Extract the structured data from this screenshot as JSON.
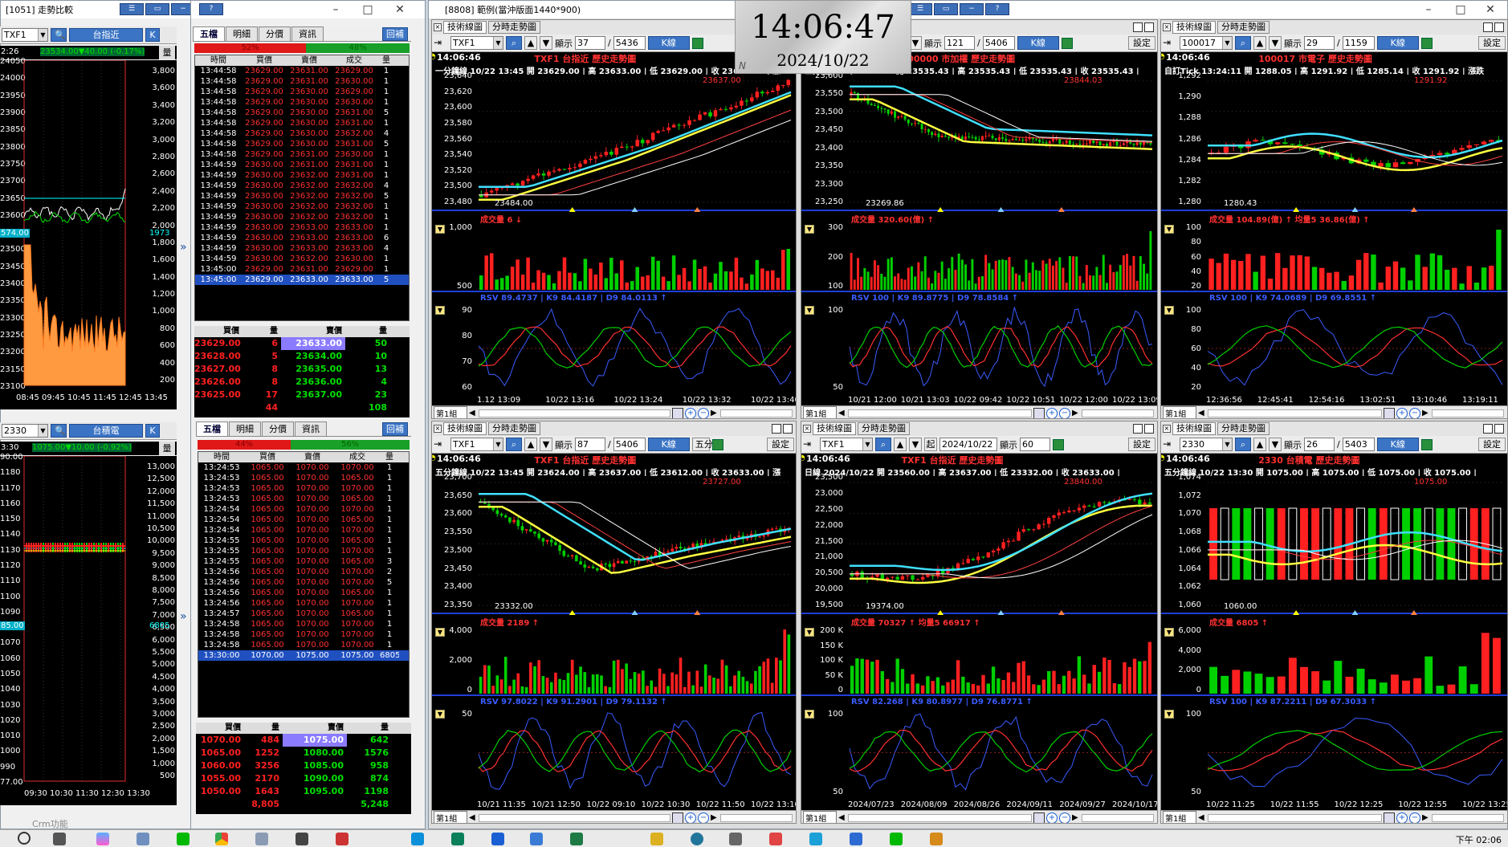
{
  "clock": {
    "time": "14:06:47",
    "date": "2024/10/22"
  },
  "left_window": {
    "title": "[1051] 走勢比較",
    "win_buttons": [
      "☰",
      "▭",
      "−",
      "?"
    ],
    "top": {
      "symbol": "TXF1",
      "name": "台指近",
      "k_btn": "K",
      "time": "2:26",
      "quote": "23534.00▼40.00 (-0.17%)",
      "qty_btn": "量",
      "price_axis": [
        "24050",
        "24000",
        "23950",
        "23900",
        "23850",
        "23800",
        "23750",
        "23700",
        "23650",
        "23600",
        "23550",
        "23500",
        "23450",
        "23400",
        "23350",
        "23300",
        "23250",
        "23200",
        "23150",
        "23100"
      ],
      "vol_axis": [
        "3,800",
        "3,600",
        "3,400",
        "3,200",
        "3,000",
        "2,800",
        "2,600",
        "2,400",
        "2,200",
        "2,000",
        "1,800",
        "1,600",
        "1,400",
        "1,200",
        "1,000",
        "800",
        "600",
        "400",
        "200"
      ],
      "cursor_price": "574.00",
      "vol_marker": "1973",
      "time_axis": "08:45 09:45 10:45 11:45 12:45 13:45"
    },
    "bottom": {
      "symbol": "2330",
      "name": "台積電",
      "k_btn": "K",
      "time": "3:30",
      "quote": "1075.00▼10.00 (-0.92%)",
      "qty_btn": "量",
      "price_axis": [
        "90.00",
        "1180",
        "1170",
        "1160",
        "1150",
        "1140",
        "1130",
        "1120",
        "1110",
        "1100",
        "1090",
        "1080",
        "1070",
        "1060",
        "1050",
        "1040",
        "1030",
        "1020",
        "1010",
        "1000",
        "990",
        "77.00"
      ],
      "vol_axis": [
        "13,000",
        "12,500",
        "12,000",
        "11,500",
        "11,000",
        "10,500",
        "10,000",
        "9,500",
        "9,000",
        "8,500",
        "8,000",
        "7,500",
        "7,000",
        "6,500",
        "6,000",
        "5,500",
        "5,000",
        "4,500",
        "4,000",
        "3,500",
        "3,000",
        "2,500",
        "2,000",
        "1,500",
        "1,000",
        "500"
      ],
      "cursor_price": "85.00",
      "vol_marker": "6805",
      "time_axis": "09:30  10:30  11:30  12:30  13:30"
    },
    "crm": "Crm功能"
  },
  "order_book_top": {
    "tabs": [
      "五檔",
      "明細",
      "分價",
      "資訊"
    ],
    "return_btn": "回補",
    "ratio_left": "52%",
    "ratio_right": "48%",
    "headers": [
      "時間",
      "買價",
      "賣價",
      "成交",
      "量"
    ],
    "ticks": [
      [
        "13:44:58",
        "23629.00",
        "23631.00",
        "23629.00",
        "1"
      ],
      [
        "13:44:58",
        "23629.00",
        "23631.00",
        "23630.00",
        "1"
      ],
      [
        "13:44:58",
        "23629.00",
        "23630.00",
        "23629.00",
        "1"
      ],
      [
        "13:44:58",
        "23629.00",
        "23630.00",
        "23630.00",
        "1"
      ],
      [
        "13:44:58",
        "23629.00",
        "23630.00",
        "23631.00",
        "5"
      ],
      [
        "13:44:58",
        "23629.00",
        "23630.00",
        "23631.00",
        "1"
      ],
      [
        "13:44:58",
        "23629.00",
        "23630.00",
        "23632.00",
        "4"
      ],
      [
        "13:44:58",
        "23629.00",
        "23630.00",
        "23631.00",
        "5"
      ],
      [
        "13:44:58",
        "23629.00",
        "23631.00",
        "23630.00",
        "1"
      ],
      [
        "13:44:59",
        "23630.00",
        "23631.00",
        "23631.00",
        "1"
      ],
      [
        "13:44:59",
        "23630.00",
        "23632.00",
        "23631.00",
        "1"
      ],
      [
        "13:44:59",
        "23630.00",
        "23632.00",
        "23632.00",
        "4"
      ],
      [
        "13:44:59",
        "23630.00",
        "23632.00",
        "23632.00",
        "5"
      ],
      [
        "13:44:59",
        "23630.00",
        "23632.00",
        "23632.00",
        "1"
      ],
      [
        "13:44:59",
        "23630.00",
        "23632.00",
        "23632.00",
        "1"
      ],
      [
        "13:44:59",
        "23630.00",
        "23633.00",
        "23633.00",
        "1"
      ],
      [
        "13:44:59",
        "23630.00",
        "23633.00",
        "23633.00",
        "6"
      ],
      [
        "13:44:59",
        "23630.00",
        "23633.00",
        "23633.00",
        "4"
      ],
      [
        "13:44:59",
        "23630.00",
        "23632.00",
        "23630.00",
        "1"
      ],
      [
        "13:45:00",
        "23629.00",
        "23631.00",
        "23629.00",
        "1"
      ],
      [
        "13:45:00",
        "23629.00",
        "23633.00",
        "23633.00",
        "5"
      ]
    ],
    "book_headers": [
      "買價",
      "量",
      "賣價",
      "量"
    ],
    "book": [
      [
        "23629.00",
        "6",
        "23633.00",
        "50"
      ],
      [
        "23628.00",
        "5",
        "23634.00",
        "10"
      ],
      [
        "23627.00",
        "8",
        "23635.00",
        "13"
      ],
      [
        "23626.00",
        "8",
        "23636.00",
        "4"
      ],
      [
        "23625.00",
        "17",
        "23637.00",
        "23"
      ]
    ],
    "totals": [
      "44",
      "108"
    ]
  },
  "order_book_bottom": {
    "tabs": [
      "五檔",
      "明細",
      "分價",
      "資訊"
    ],
    "return_btn": "回補",
    "ratio_left": "44%",
    "ratio_right": "56%",
    "headers": [
      "時間",
      "買價",
      "賣價",
      "成交",
      "量"
    ],
    "ticks": [
      [
        "13:24:53",
        "1065.00",
        "1070.00",
        "1070.00",
        "1"
      ],
      [
        "13:24:53",
        "1065.00",
        "1070.00",
        "1065.00",
        "1"
      ],
      [
        "13:24:53",
        "1065.00",
        "1070.00",
        "1070.00",
        "1"
      ],
      [
        "13:24:53",
        "1065.00",
        "1070.00",
        "1065.00",
        "1"
      ],
      [
        "13:24:54",
        "1065.00",
        "1070.00",
        "1070.00",
        "1"
      ],
      [
        "13:24:54",
        "1065.00",
        "1070.00",
        "1065.00",
        "1"
      ],
      [
        "13:24:54",
        "1065.00",
        "1070.00",
        "1070.00",
        "1"
      ],
      [
        "13:24:55",
        "1065.00",
        "1070.00",
        "1065.00",
        "1"
      ],
      [
        "13:24:55",
        "1065.00",
        "1070.00",
        "1070.00",
        "1"
      ],
      [
        "13:24:55",
        "1065.00",
        "1070.00",
        "1065.00",
        "3"
      ],
      [
        "13:24:56",
        "1065.00",
        "1070.00",
        "1070.00",
        "2"
      ],
      [
        "13:24:56",
        "1065.00",
        "1070.00",
        "1070.00",
        "5"
      ],
      [
        "13:24:56",
        "1065.00",
        "1070.00",
        "1065.00",
        "1"
      ],
      [
        "13:24:56",
        "1065.00",
        "1070.00",
        "1070.00",
        "1"
      ],
      [
        "13:24:57",
        "1065.00",
        "1070.00",
        "1065.00",
        "1"
      ],
      [
        "13:24:58",
        "1065.00",
        "1070.00",
        "1070.00",
        "1"
      ],
      [
        "13:24:58",
        "1065.00",
        "1070.00",
        "1070.00",
        "1"
      ],
      [
        "13:24:58",
        "1065.00",
        "1070.00",
        "1070.00",
        "1"
      ],
      [
        "13:30:00",
        "1070.00",
        "1075.00",
        "1075.00",
        "6805"
      ]
    ],
    "book_headers": [
      "買價",
      "量",
      "賣價",
      "量"
    ],
    "book": [
      [
        "1070.00",
        "484",
        "1075.00",
        "642"
      ],
      [
        "1065.00",
        "1252",
        "1080.00",
        "1576"
      ],
      [
        "1060.00",
        "3256",
        "1085.00",
        "958"
      ],
      [
        "1055.00",
        "2170",
        "1090.00",
        "874"
      ],
      [
        "1050.00",
        "1643",
        "1095.00",
        "1198"
      ]
    ],
    "totals": [
      "8,805",
      "5,248"
    ]
  },
  "main_window": {
    "title": "[8808] 範例(當沖版面1440*900)",
    "win_buttons": [
      "☰",
      "▭",
      "−",
      "?"
    ],
    "charts": [
      {
        "tabs": [
          "技術線圖",
          "分時走勢圖"
        ],
        "symbol": "TXF1",
        "display_lbl": "顯示",
        "count": "37",
        "total": "5436",
        "kline": "K線",
        "set": "設定",
        "clock": "14:06:46",
        "title": "TXF1 台指近  歷史走勢圖",
        "header": "一分鐘線 10/22 13:45 開 23629.00 | 高 23633.00 | 低 23629.00 | 收 23633.00 | 漲",
        "price_axis": [
          "23,640",
          "23,620",
          "23,600",
          "23,580",
          "23,560",
          "23,540",
          "23,520",
          "23,500",
          "23,480"
        ],
        "hi_mark": "23637.00",
        "lo_mark": "23484.00",
        "vol_title": "成交量 6 ↓",
        "vol_axis": [
          "1,000",
          "500"
        ],
        "kd_title": "RSV 89.4737 | K9 84.4187 | D9 84.0113 ↑",
        "kd_axis": [
          "90",
          "80",
          "70",
          "60"
        ],
        "x_axis": [
          "1.12 13:09",
          "10/22 13:16",
          "10/22 13:24",
          "10/22 13:32",
          "10/22 13:40"
        ],
        "group": "第1組"
      },
      {
        "tabs": [
          "技術線圖",
          "分時走勢圖"
        ],
        "symbol": "100000",
        "display_lbl": "顯示",
        "count": "121",
        "total": "5406",
        "kline": "K線",
        "set": "設定",
        "clock": "14:06:46",
        "title": "100000 市加權  歷史走勢圖",
        "header": "三分鐘線 10/22 13:30 開 23535.43 | 高 23535.43 | 低 23535.43 | 收 23535.43 |",
        "price_axis": [
          "23,600",
          "23,550",
          "23,500",
          "23,450",
          "23,400",
          "23,350",
          "23,300",
          "23,250"
        ],
        "hi_mark": "23844.03",
        "lo_mark": "23269.86",
        "vol_title": "成交量 320.60(億) ↑",
        "vol_axis": [
          "300",
          "200",
          "100"
        ],
        "kd_title": "RSV 100 | K9 89.8775 | D9 78.8584 ↑",
        "kd_axis": [
          "100",
          "50"
        ],
        "x_axis": [
          "10/21 12:00",
          "10/21 13:03",
          "10/22 09:42",
          "10/22 10:51",
          "10/22 12:00",
          "10/22 13:09"
        ],
        "group": "第1組"
      },
      {
        "tabs": [
          "技術線圖",
          "分時走勢圖"
        ],
        "symbol": "100017",
        "display_lbl": "顯示",
        "count": "29",
        "total": "1159",
        "kline": "K線",
        "set": "設定",
        "clock": "14:06:46",
        "title": "100017 市電子  歷史走勢圖",
        "header": "自訂Tick 13:24:11 開 1288.05 | 高 1291.92 | 低 1285.14 | 收 1291.92 | 漲跌",
        "price_axis": [
          "1,292",
          "1,290",
          "1,288",
          "1,286",
          "1,284",
          "1,282",
          "1,280"
        ],
        "hi_mark": "1291.92",
        "lo_mark": "1280.43",
        "vol_title": "成交量 104.89(億) ↑  均量5 36.86(億) ↑",
        "vol_axis": [
          "100",
          "80",
          "60",
          "40",
          "20"
        ],
        "kd_title": "RSV 100 | K9 74.0689 | D9 69.8551 ↑",
        "kd_axis": [
          "100",
          "80",
          "60",
          "40",
          "20"
        ],
        "x_axis": [
          "12:36:56",
          "12:45:41",
          "12:54:16",
          "13:02:51",
          "13:10:46",
          "13:19:11"
        ],
        "group": "第1組"
      },
      {
        "tabs": [
          "技術線圖",
          "分時走勢圖"
        ],
        "symbol": "TXF1",
        "display_lbl": "顯示",
        "count": "87",
        "total": "5406",
        "kline": "K線",
        "set": "設定",
        "extra": "五分",
        "clock": "14:06:46",
        "title": "TXF1 台指近  歷史走勢圖",
        "header": "五分鐘線 10/22 13:45 開 23624.00 | 高 23637.00 | 低 23612.00 | 收 23633.00 | 漲",
        "price_axis": [
          "23,700",
          "23,650",
          "23,600",
          "23,550",
          "23,500",
          "23,450",
          "23,400",
          "23,350"
        ],
        "hi_mark": "23727.00",
        "lo_mark": "23332.00",
        "vol_title": "成交量 2189 ↑",
        "vol_axis": [
          "4,000",
          "2,000",
          "0"
        ],
        "kd_title": "RSV 97.8022 | K9 91.2901 | D9 79.1132 ↑",
        "kd_axis": [
          "50"
        ],
        "x_axis": [
          "10/21 11:35",
          "10/21 12:50",
          "10/22 09:10",
          "10/22 10:30",
          "10/22 11:50",
          "10/22 13:10"
        ],
        "group": "第1組"
      },
      {
        "tabs": [
          "技術線圖",
          "分時走勢圖"
        ],
        "symbol": "TXF1",
        "display_lbl": "顯示",
        "count": "60",
        "total": "",
        "kline": "",
        "set": "設定",
        "start_lbl": "起",
        "start_date": "2024/10/22",
        "clock": "14:06:46",
        "title": "TXF1 台指近  歷史走勢圖",
        "header": "日線 2024/10/22 開 23560.00 | 高 23637.00 | 低 23332.00 | 收 23633.00 |",
        "price_axis": [
          "23,500",
          "23,000",
          "22,500",
          "22,000",
          "21,500",
          "21,000",
          "20,500",
          "20,000",
          "19,500"
        ],
        "hi_mark": "23840.00",
        "lo_mark": "19374.00",
        "vol_title": "成交量 70327 ↑  均量5 66917 ↑",
        "vol_axis": [
          "200 K",
          "150 K",
          "100 K",
          "50 K",
          "0"
        ],
        "kd_title": "RSV 82.268 | K9 80.8977 | D9 76.8771 ↑",
        "kd_axis": [
          "100",
          "50"
        ],
        "x_axis": [
          "2024/07/23",
          "2024/08/09",
          "2024/08/26",
          "2024/09/11",
          "2024/09/27",
          "2024/10/17"
        ],
        "group": "第1組"
      },
      {
        "tabs": [
          "技術線圖",
          "分時走勢圖"
        ],
        "symbol": "2330",
        "display_lbl": "顯示",
        "count": "26",
        "total": "5403",
        "kline": "K線",
        "set": "設定",
        "clock": "14:06:46",
        "title": "2330 台積電  歷史走勢圖",
        "header": "五分鐘線 10/22 13:30 開 1075.00 | 高 1075.00 | 低 1075.00 | 收 1075.00 |",
        "price_axis": [
          "1,074",
          "1,072",
          "1,070",
          "1,068",
          "1,066",
          "1,064",
          "1,062",
          "1,060"
        ],
        "hi_mark": "1075.00",
        "lo_mark": "1060.00",
        "vol_title": "成交量 6805 ↑",
        "vol_axis": [
          "6,000",
          "4,000",
          "2,000",
          "0"
        ],
        "kd_title": "RSV 100 | K9 87.2211 | D9 67.3033 ↑",
        "kd_axis": [
          "100",
          "50"
        ],
        "x_axis": [
          "10/22 11:25",
          "10/22 11:55",
          "10/22 12:25",
          "10/22 12:55",
          "10/22 13:25"
        ],
        "group": "第1組"
      }
    ]
  },
  "taskbar": {
    "clock": "下午 02:06"
  },
  "colors": {
    "up": "#ff2020",
    "down": "#00e000",
    "ma1": "#ffff40",
    "ma2": "#40e0ff",
    "sep": "#1f3fd8"
  }
}
